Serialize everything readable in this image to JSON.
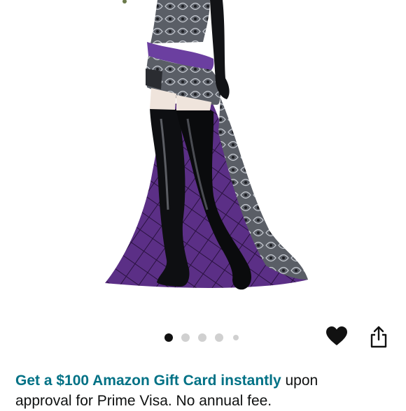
{
  "product_gallery": {
    "image_description_icon": "figurine-photo",
    "dot_count": 5,
    "active_dot_index": 0
  },
  "actions": {
    "wishlist_icon": "heart-icon",
    "share_icon": "share-icon"
  },
  "promo": {
    "link_text": "Get a $100 Amazon Gift Card instantly",
    "line1_rest": " upon",
    "line2": "approval for Prime Visa. No annual fee."
  },
  "colors": {
    "link": "#007185",
    "text": "#0f1111",
    "dot_active": "#111111",
    "dot_inactive": "#d0d0d0",
    "accent_purple": "#5b2f86"
  }
}
